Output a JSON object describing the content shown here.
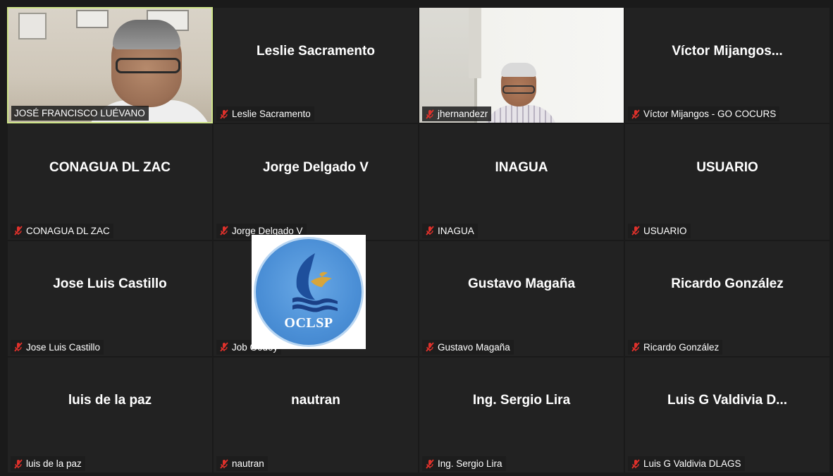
{
  "colors": {
    "background": "#1a1a1a",
    "tile": "#222222",
    "active_border": "#cfe58a",
    "muted_mic": "#e0312b"
  },
  "participants": [
    {
      "display_name": "",
      "label": "JOSÉ FRANCISCO LUÉVANO",
      "video": true,
      "muted": false,
      "active": true
    },
    {
      "display_name": "Leslie Sacramento",
      "label": "Leslie Sacramento",
      "video": false,
      "muted": true
    },
    {
      "display_name": "",
      "label": "jhernandezr",
      "video": true,
      "muted": true
    },
    {
      "display_name": "Víctor Mijangos...",
      "label": "Víctor Mijangos - GO COCURS",
      "video": false,
      "muted": true
    },
    {
      "display_name": "CONAGUA DL ZAC",
      "label": "CONAGUA DL ZAC",
      "video": false,
      "muted": true
    },
    {
      "display_name": "Jorge Delgado V",
      "label": "Jorge Delgado V",
      "video": false,
      "muted": true
    },
    {
      "display_name": "INAGUA",
      "label": "INAGUA",
      "video": false,
      "muted": true
    },
    {
      "display_name": "USUARIO",
      "label": "USUARIO",
      "video": false,
      "muted": true
    },
    {
      "display_name": "Jose Luis Castillo",
      "label": "Jose Luis Castillo",
      "video": false,
      "muted": true
    },
    {
      "display_name": "",
      "label": "Job Godoy",
      "video": false,
      "muted": true
    },
    {
      "display_name": "Gustavo Magaña",
      "label": "Gustavo Magaña",
      "video": false,
      "muted": true
    },
    {
      "display_name": "Ricardo González",
      "label": "Ricardo González",
      "video": false,
      "muted": true
    },
    {
      "display_name": "luis de la paz",
      "label": "luis de la paz",
      "video": false,
      "muted": true
    },
    {
      "display_name": "nautran",
      "label": "nautran",
      "video": false,
      "muted": true
    },
    {
      "display_name": "Ing. Sergio Lira",
      "label": "Ing. Sergio Lira",
      "video": false,
      "muted": true
    },
    {
      "display_name": "Luis G Valdivia D...",
      "label": "Luis G Valdivia DLAGS",
      "video": false,
      "muted": true
    }
  ],
  "logo_overlay": {
    "text": "OCLSP",
    "icon": "oclsp-logo-icon"
  }
}
